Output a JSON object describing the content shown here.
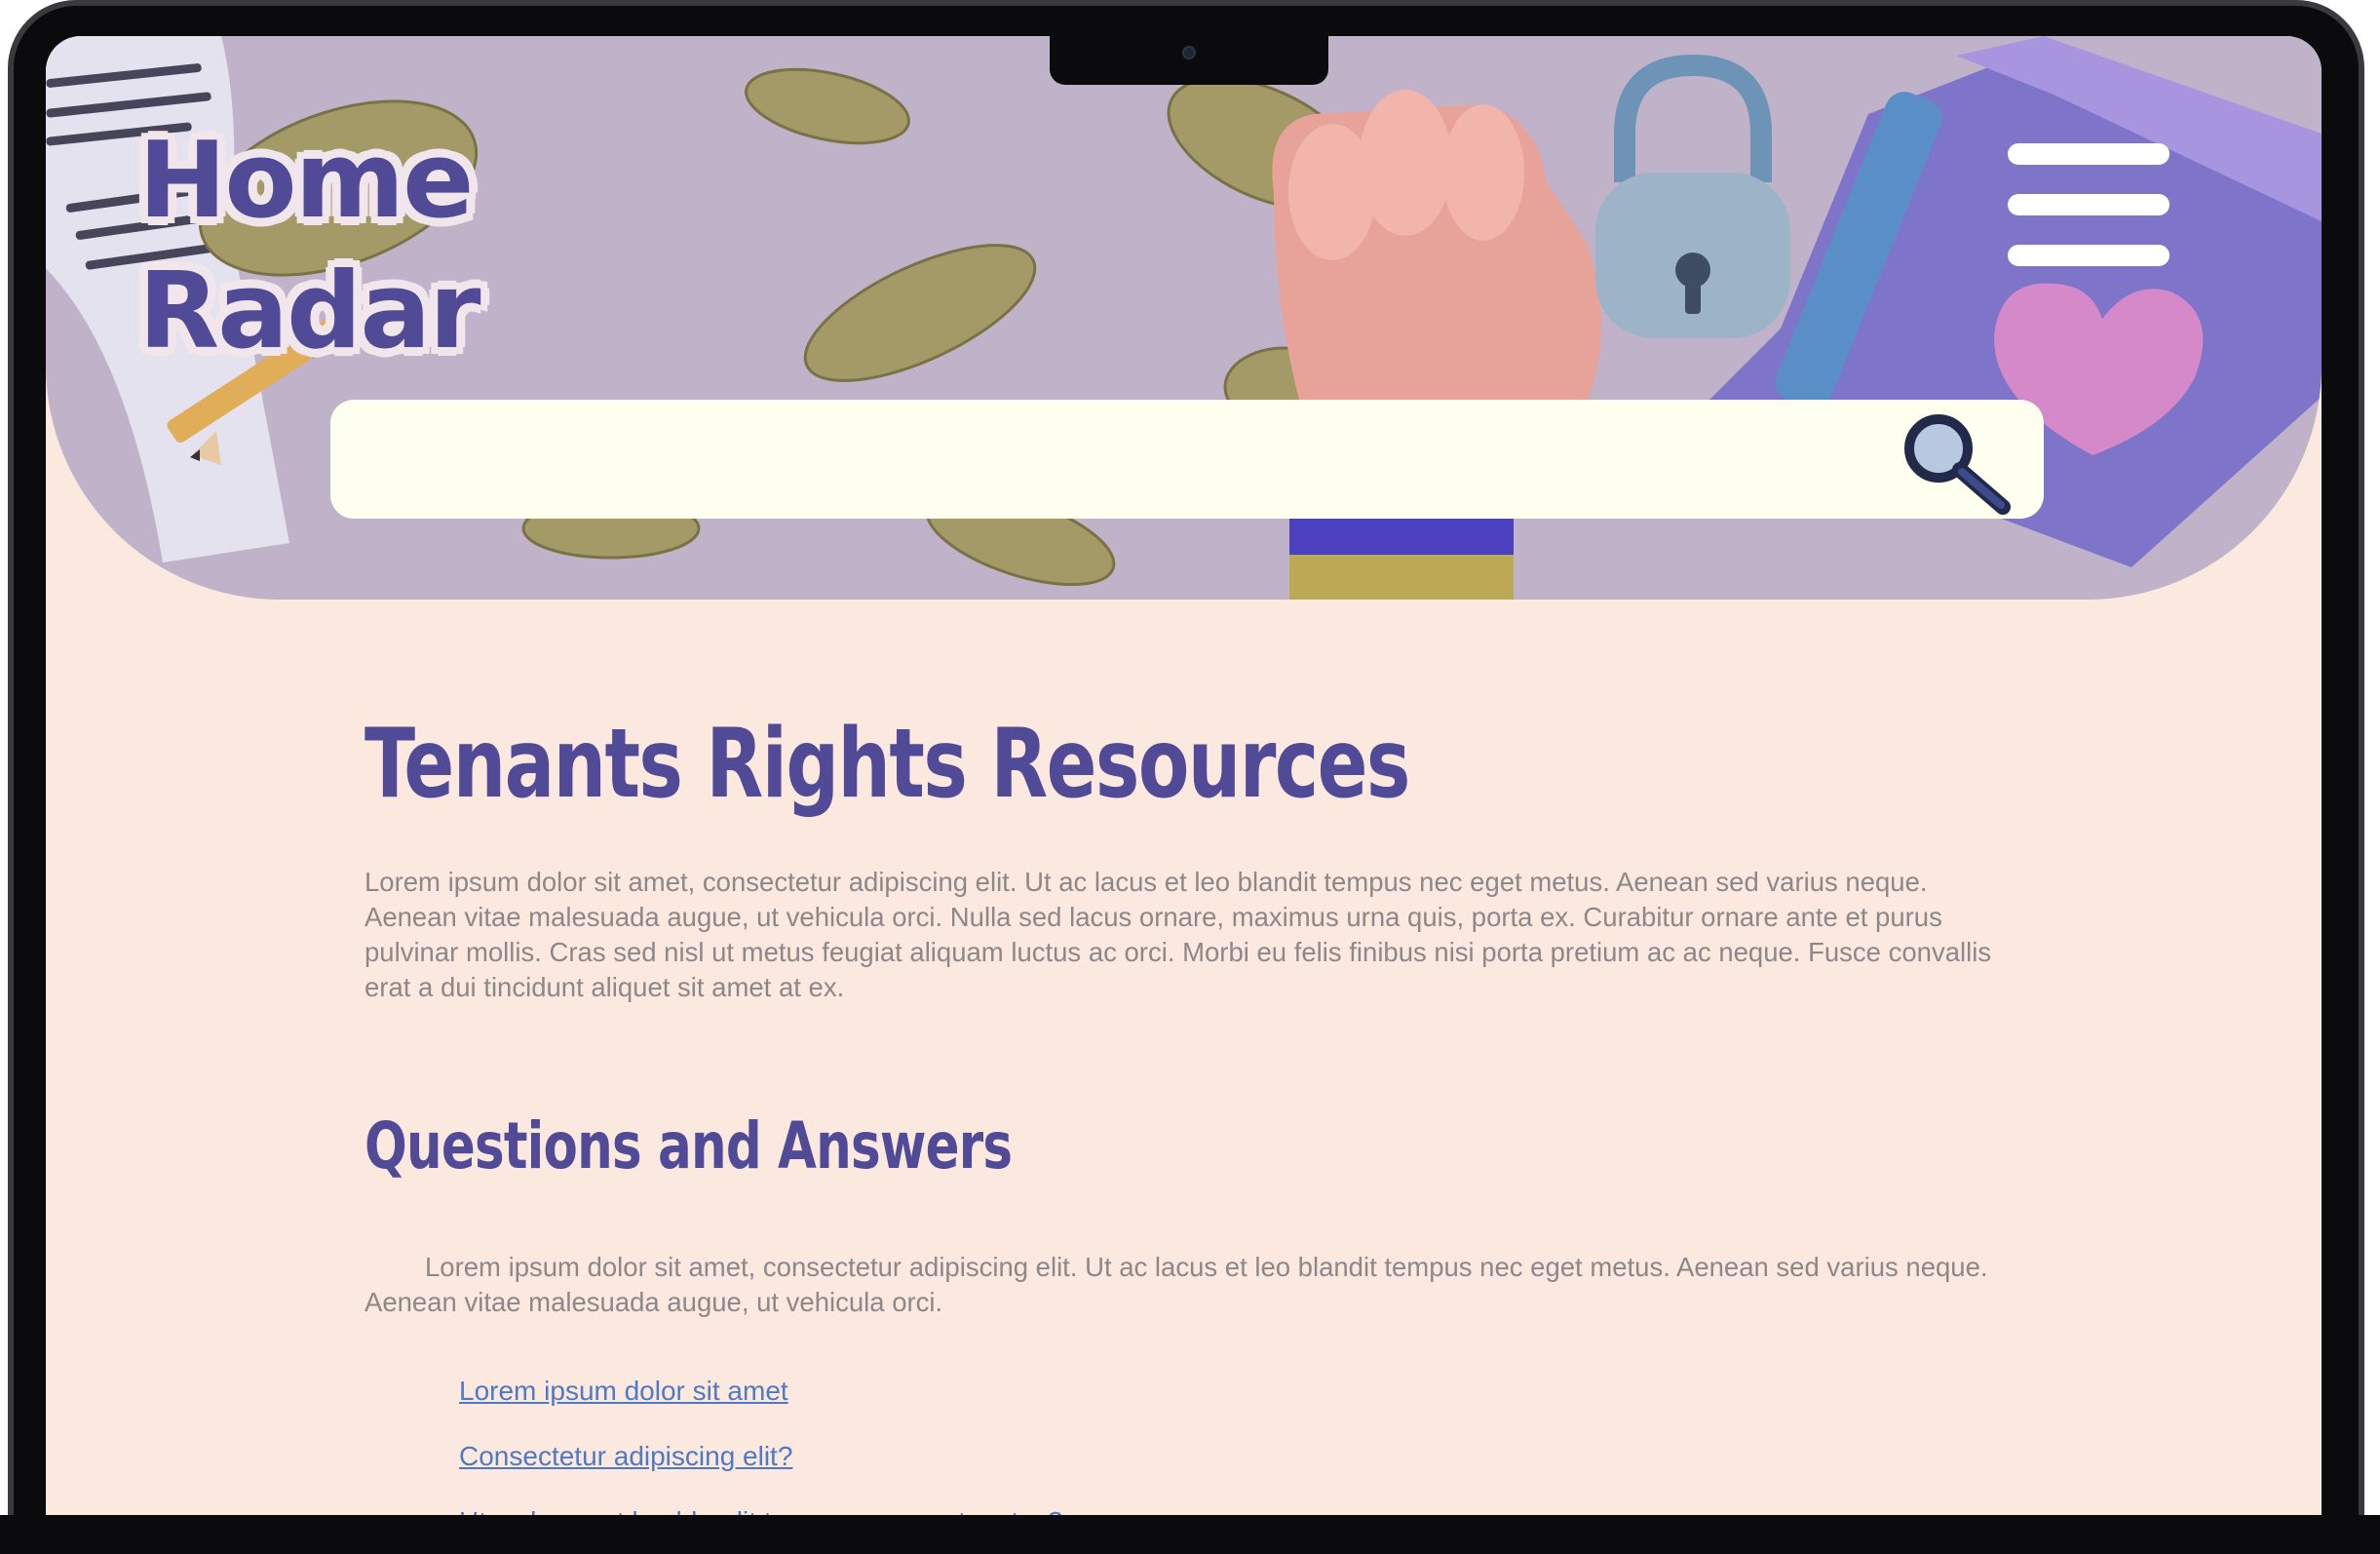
{
  "header": {
    "logo_line1": "Home",
    "logo_line2": "Radar",
    "menu_icon": "hamburger-menu-icon",
    "search_icon": "magnifier-icon",
    "search_value": ""
  },
  "main": {
    "title": "Tenants Rights Resources",
    "intro": "Lorem ipsum dolor sit amet, consectetur adipiscing elit. Ut ac lacus et leo blandit tempus nec eget metus. Aenean sed varius neque. Aenean vitae malesuada augue, ut vehicula orci. Nulla sed lacus ornare, maximus urna quis, porta ex. Curabitur ornare ante et purus pulvinar mollis. Cras sed nisl ut metus feugiat aliquam luctus ac orci. Morbi eu felis finibus nisi porta pretium ac ac neque. Fusce convallis erat a dui tincidunt aliquet sit amet at ex.",
    "qa_heading": "Questions and Answers",
    "qa_intro": "Lorem ipsum dolor sit amet, consectetur adipiscing elit. Ut ac lacus et leo blandit tempus nec eget metus. Aenean sed varius neque. Aenean vitae malesuada augue, ut vehicula orci.",
    "links": [
      "Lorem ipsum dolor sit amet",
      "Consectetur adipiscing elit?",
      "Ut ac lacus et leo blandit tempus nec eget metus?"
    ]
  },
  "colors": {
    "brand": "#514a96",
    "page_background": "#fbe9e0",
    "hero_background": "#c0b3c9",
    "link": "#4f79c4",
    "body_text": "#8d8789"
  }
}
